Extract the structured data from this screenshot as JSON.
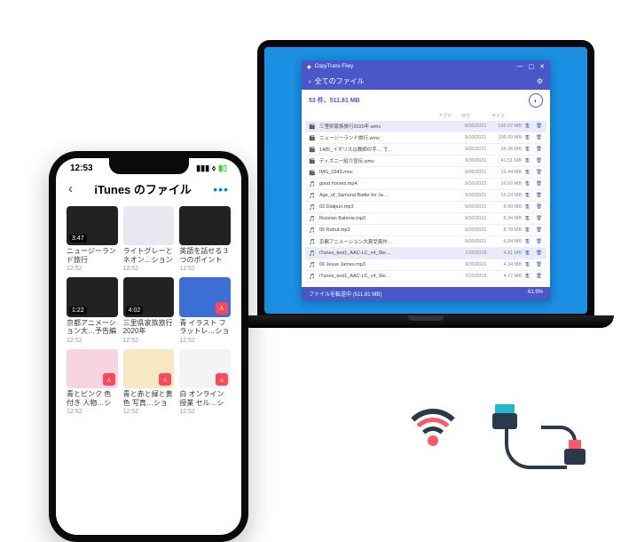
{
  "laptop": {
    "app_name": "CopyTrans Filey",
    "header_title": "全てのファイル",
    "summary": "53 件、511.81 MB",
    "columns": {
      "app": "アプリ",
      "date": "日付",
      "size": "サイズ"
    },
    "files": [
      {
        "icon": "🎬",
        "name": "三里県家族旅行2020年.wmv",
        "date": "9/30/2021",
        "size": "142.07 MB",
        "sel": true
      },
      {
        "icon": "🎬",
        "name": "ニュージーランド旅行.wmv",
        "date": "9/30/2021",
        "size": "106.00 MB"
      },
      {
        "icon": "🎬",
        "name": "1485_イギリスは教師の手… で…",
        "date": "9/30/2021",
        "size": "34.36 MB"
      },
      {
        "icon": "🎬",
        "name": "ディズニー紹介宣伝.wmv",
        "date": "9/30/2021",
        "size": "41.51 MB"
      },
      {
        "icon": "🎬",
        "name": "IMG_0343.mov",
        "date": "9/30/2021",
        "size": "19.44 MB"
      },
      {
        "icon": "🎵",
        "name": "good horses.mp4",
        "date": "9/30/2021",
        "size": "16.60 MB"
      },
      {
        "icon": "🎵",
        "name": "Age_of_Samurai Battle for Ja…",
        "date": "9/30/2021",
        "size": "16.24 MB"
      },
      {
        "icon": "🎵",
        "name": "02 Dalipuri.mp3",
        "date": "9/30/2021",
        "size": "8.90 MB"
      },
      {
        "icon": "🎵",
        "name": "Russian Balenia.mp3",
        "date": "9/30/2021",
        "size": "8.34 MB"
      },
      {
        "icon": "🎵",
        "name": "05 Rahut.mp3",
        "date": "9/30/2021",
        "size": "8.78 MB"
      },
      {
        "icon": "🎵",
        "name": "京都アニメーション大賞受賞作…",
        "date": "9/30/2021",
        "size": "6.84 MB"
      },
      {
        "icon": "🎵",
        "name": "iTunes_test1_AAC-LC_v4_Ste…",
        "date": "7/20/2019",
        "size": "4.81 MB",
        "sel": true
      },
      {
        "icon": "🎵",
        "name": "06 Jesse James.mp3",
        "date": "9/30/2021",
        "size": "4.34 MB"
      },
      {
        "icon": "🎵",
        "name": "iTunes_test1_AAC-LC_v4_Ste…",
        "date": "7/20/2019",
        "size": "4.77 MB"
      }
    ],
    "footer_left": "ファイルを転送中 (511.81 MB)",
    "footer_right": "61.9%"
  },
  "phone": {
    "time": "12:53",
    "title": "iTunes のファイル",
    "items": [
      {
        "title": "ニュージーランド旅行",
        "time": "12:52",
        "variant": "dark",
        "dur": "3:47"
      },
      {
        "title": "ライトグレーとネオン…ション",
        "time": "12:52",
        "variant": "light"
      },
      {
        "title": "英語を話せる３つのポイント",
        "time": "12:52",
        "variant": "dark"
      },
      {
        "title": "京都アニメーション大…予告編",
        "time": "12:52",
        "variant": "dark",
        "dur": "1:22"
      },
      {
        "title": "三里県家族旅行2020年",
        "time": "12:52",
        "variant": "dark",
        "dur": "4:02"
      },
      {
        "title": "青 イラスト フラットレ…ション",
        "time": "12:52",
        "variant": "blue",
        "badge": true
      },
      {
        "title": "青とピンク 色付き 人物…ション",
        "time": "12:52",
        "variant": "pink",
        "badge": true
      },
      {
        "title": "青と赤と緑と黄色 写真…ション",
        "time": "12:52",
        "variant": "yellow",
        "badge": true
      },
      {
        "title": "白 オンライン授業 セル…ション",
        "time": "12:52",
        "variant": "white",
        "badge": true
      }
    ]
  }
}
